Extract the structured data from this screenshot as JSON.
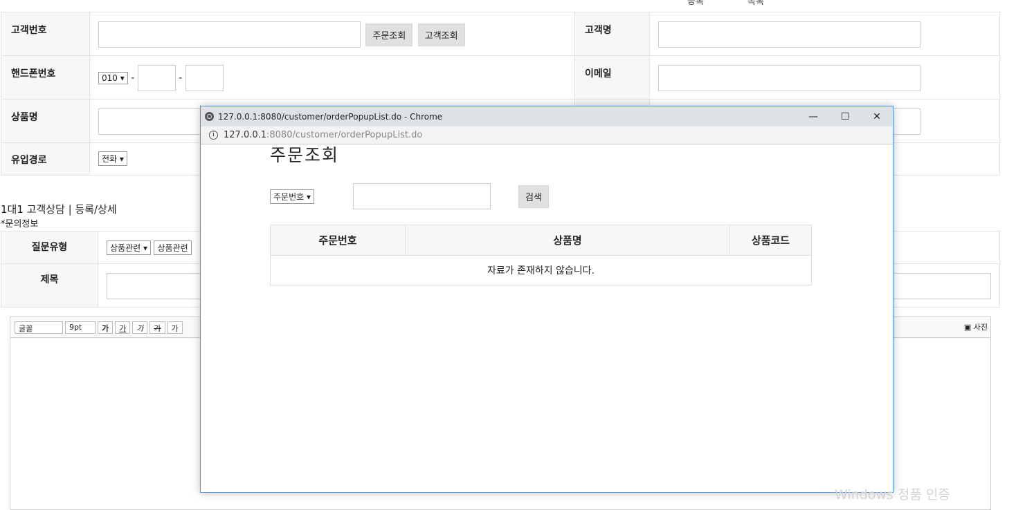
{
  "background": {
    "top_fragments": [
      "등록",
      "목록"
    ],
    "form": {
      "customer_no_label": "고객번호",
      "order_lookup_btn": "주문조회",
      "customer_lookup_btn": "고객조회",
      "customer_name_label": "고객명",
      "phone_label": "핸드폰번호",
      "phone_prefix": "010 ▾",
      "dash": "-",
      "email_label": "이메일",
      "product_label": "상품명",
      "channel_label": "유입경로",
      "channel_value": "전화 ▾"
    },
    "section_title": "1대1 고객상담 | 등록/상세",
    "section_sub": "*문의정보",
    "question": {
      "type_label": "질문유형",
      "type_value1": "상품관련 ▾",
      "type_value2": "상품관련",
      "subject_label": "제목"
    },
    "editor": {
      "font": "글꼴",
      "size": "9pt",
      "bold": "가",
      "underline": "가",
      "italic": "가",
      "strike": "가",
      "color": "가",
      "photo": "사진"
    }
  },
  "popup": {
    "title_bar": "127.0.0.1:8080/customer/orderPopupList.do - Chrome",
    "address_host": "127.0.0.1",
    "address_rest": ":8080/customer/orderPopupList.do",
    "heading": "주문조회",
    "search_select": "주문번호 ▾",
    "search_btn": "검색",
    "columns": [
      "주문번호",
      "상품명",
      "상품코드"
    ],
    "empty_message": "자료가 존재하지 않습니다."
  },
  "watermark": "Windows 정품 인증"
}
